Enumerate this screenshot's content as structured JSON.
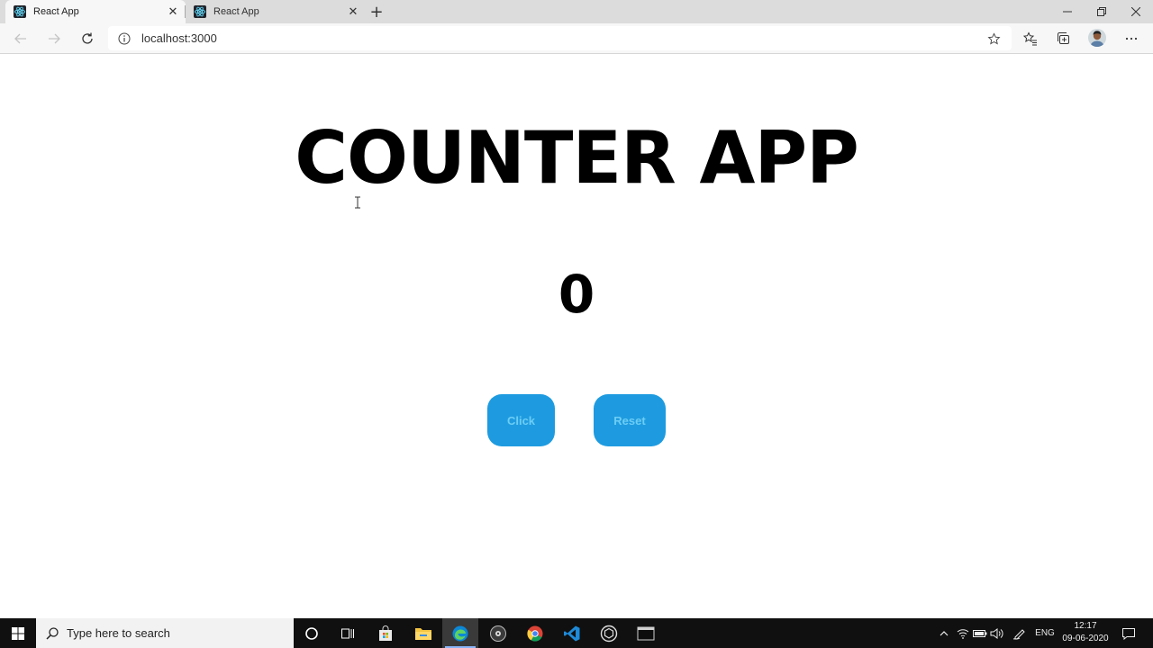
{
  "browser": {
    "tabs": [
      {
        "label": "React App",
        "active": true
      },
      {
        "label": "React App",
        "active": false
      }
    ],
    "address_bar": {
      "url": "localhost:3000"
    }
  },
  "app": {
    "title": "COUNTER APP",
    "counter": "0",
    "buttons": {
      "click_label": "Click",
      "reset_label": "Reset"
    },
    "colors": {
      "button_bg": "#1e9be0",
      "button_text": "#6ccdf5"
    }
  },
  "taskbar": {
    "search_placeholder": "Type here to search",
    "apps": [
      "cortana-icon",
      "task-view-icon",
      "store-icon",
      "file-explorer-icon",
      "edge-icon",
      "obs-icon",
      "chrome-icon",
      "vscode-icon",
      "unity-icon",
      "terminal-icon"
    ],
    "language": "ENG",
    "time": "12:17",
    "date": "09-06-2020"
  }
}
